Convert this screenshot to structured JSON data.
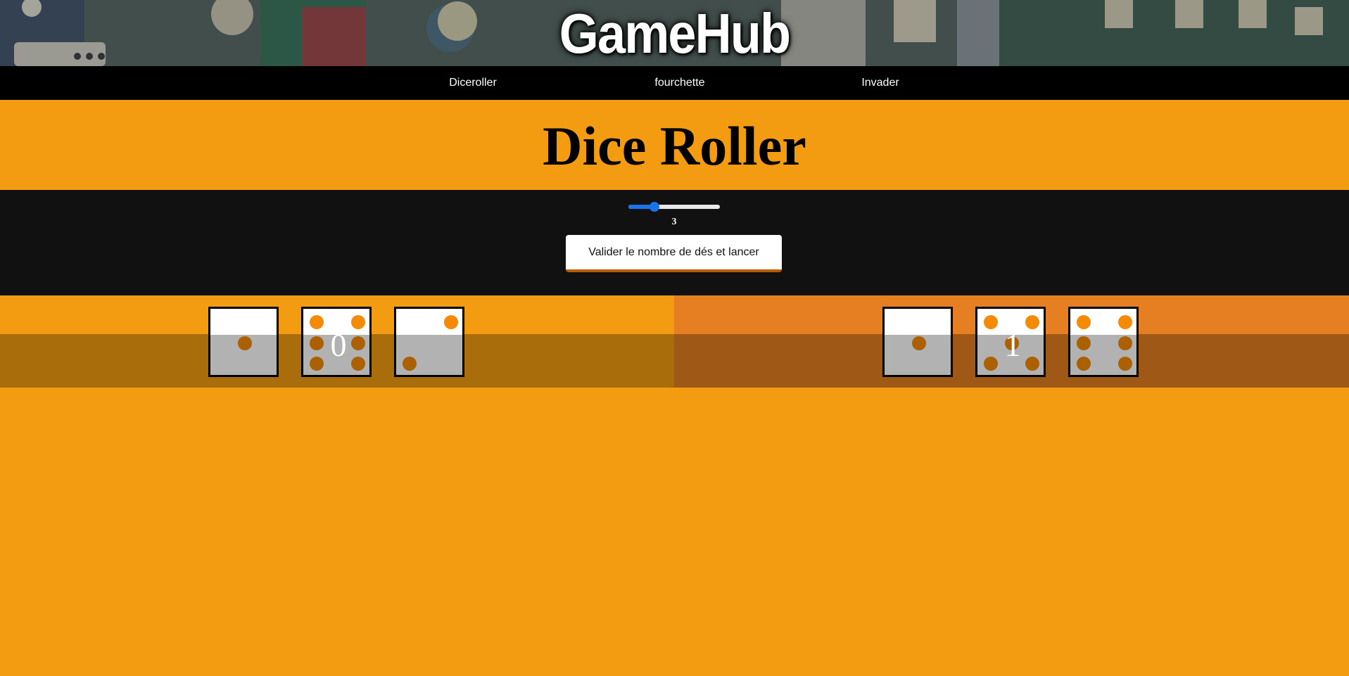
{
  "header": {
    "title": "GameHub",
    "background_colors": [
      "#3f4d47",
      "#6b7b73",
      "#2d3a35",
      "#8a3a3a",
      "#c9c2a8"
    ]
  },
  "nav": {
    "items": [
      {
        "label": "Diceroller"
      },
      {
        "label": "fourchette"
      },
      {
        "label": "Invader"
      }
    ]
  },
  "main": {
    "title": "Dice Roller"
  },
  "controls": {
    "slider": {
      "min": 1,
      "max": 10,
      "value": 3,
      "display": "3",
      "accent_color": "#1a73e8"
    },
    "roll_button_label": "Valider le nombre de dés et lancer"
  },
  "players": [
    {
      "score": "0",
      "dice": [
        1,
        6,
        2
      ],
      "background": "#f39c12"
    },
    {
      "score": "1",
      "dice": [
        1,
        5,
        6
      ],
      "background": "#e67e22"
    }
  ],
  "colors": {
    "page_background": "#f39c12",
    "nav_background": "#000000",
    "controls_background": "#111111",
    "pip_color": "#f58a07"
  }
}
